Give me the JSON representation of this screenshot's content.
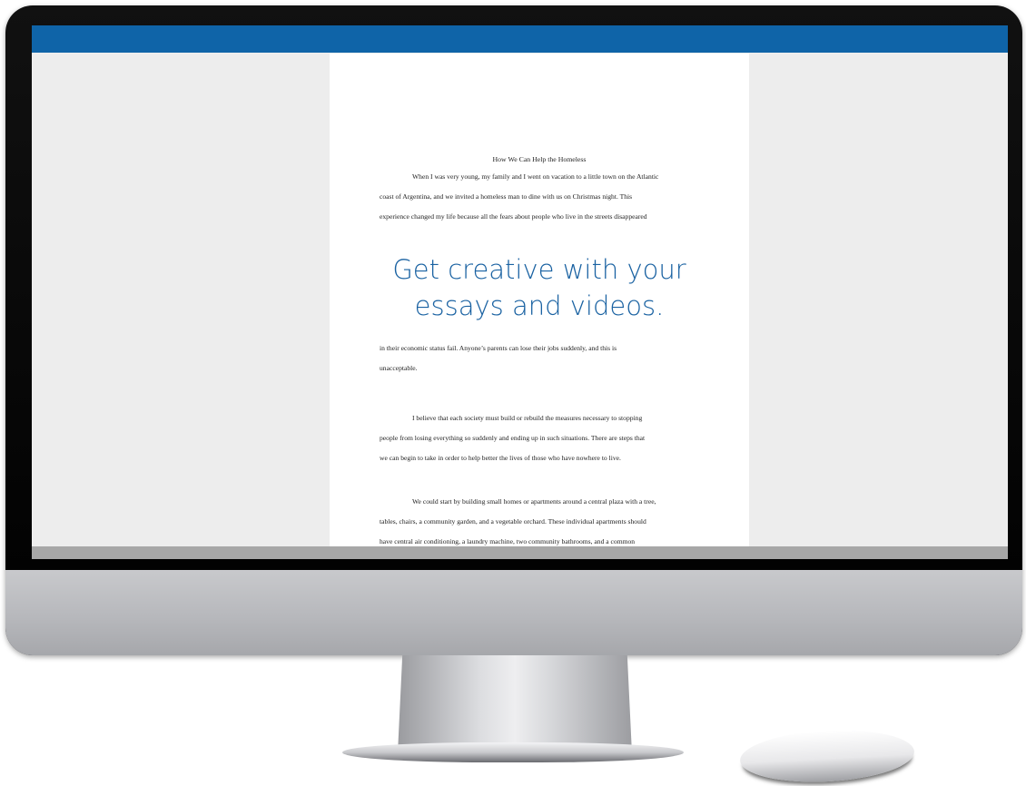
{
  "document": {
    "title": "How We Can Help the Homeless",
    "paragraph1": [
      "When I was very young, my family and I went on vacation to a little town on the Atlantic",
      "coast of Argentina, and we invited a homeless man to dine with us on Christmas night. This",
      "experience changed my life because all the fears about people who live in the streets disappeared"
    ],
    "paragraph2": [
      "in their economic status fail. Anyone’s parents can lose their jobs suddenly, and this is",
      "unacceptable."
    ],
    "paragraph3": [
      "I believe that each society must build or rebuild the measures necessary to stopping",
      "people from losing everything so suddenly and ending up in such situations. There are steps that",
      "we can begin to take in order to help better the lives of those who have nowhere to live."
    ],
    "paragraph4": [
      "We could start by building small homes or apartments around a central plaza with a tree,",
      "tables, chairs, a community garden, and a vegetable orchard. These individual apartments should",
      "have central air conditioning, a laundry machine, two community bathrooms, and a common"
    ]
  },
  "overlay": {
    "line1": "Get creative with your",
    "line2": "essays and videos."
  },
  "colors": {
    "titlebar": "#0f64a8",
    "overlay_text": "#1a62a2",
    "canvas": "#ededed"
  }
}
